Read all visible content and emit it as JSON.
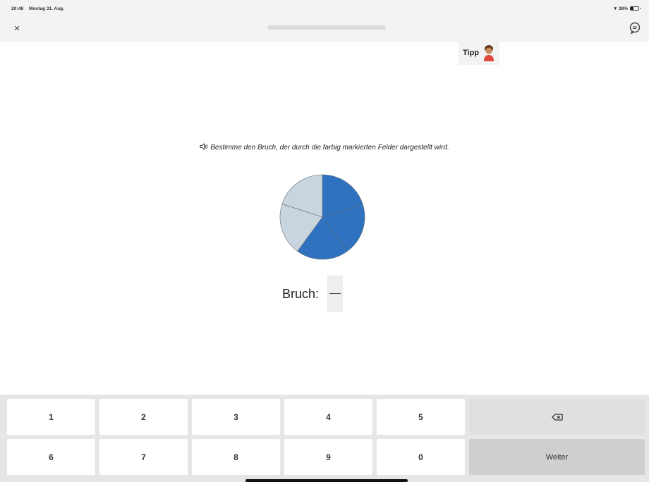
{
  "status_bar": {
    "time": "20:48",
    "date": "Montag 31. Aug.",
    "battery": "38%"
  },
  "top_bar": {
    "close_label": "×",
    "progress": 0
  },
  "tip": {
    "label": "Tipp"
  },
  "question": {
    "instruction": "Bestimme den Bruch, der durch die farbig markierten Felder dargestellt wird."
  },
  "figure": {
    "slices_total": 5,
    "slices_colored": 3,
    "colored_color": "#2f72bf",
    "uncolored_color": "#c8d4de"
  },
  "answer": {
    "label": "Bruch:"
  },
  "keyboard": {
    "row1": [
      "1",
      "2",
      "3",
      "4",
      "5"
    ],
    "row2": [
      "6",
      "7",
      "8",
      "9",
      "0"
    ],
    "submit_label": "Weiter"
  }
}
